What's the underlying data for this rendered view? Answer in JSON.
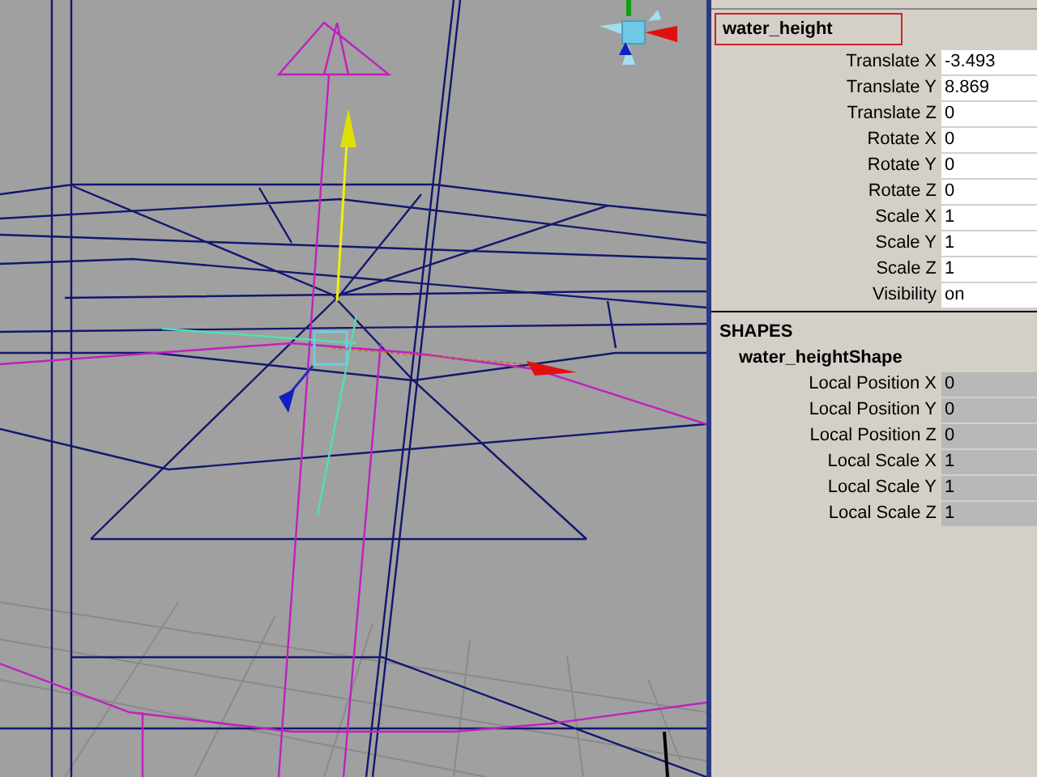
{
  "object": {
    "name": "water_height",
    "attributes": [
      {
        "label": "Translate X",
        "value": "-3.493",
        "disabled": false
      },
      {
        "label": "Translate Y",
        "value": "8.869",
        "disabled": false
      },
      {
        "label": "Translate Z",
        "value": "0",
        "disabled": false
      },
      {
        "label": "Rotate X",
        "value": "0",
        "disabled": false
      },
      {
        "label": "Rotate Y",
        "value": "0",
        "disabled": false
      },
      {
        "label": "Rotate Z",
        "value": "0",
        "disabled": false
      },
      {
        "label": "Scale X",
        "value": "1",
        "disabled": false
      },
      {
        "label": "Scale Y",
        "value": "1",
        "disabled": false
      },
      {
        "label": "Scale Z",
        "value": "1",
        "disabled": false
      },
      {
        "label": "Visibility",
        "value": "on",
        "disabled": false
      }
    ]
  },
  "shapes": {
    "title": "SHAPES",
    "name": "water_heightShape",
    "attributes": [
      {
        "label": "Local Position X",
        "value": "0",
        "disabled": true
      },
      {
        "label": "Local Position Y",
        "value": "0",
        "disabled": true
      },
      {
        "label": "Local Position Z",
        "value": "0",
        "disabled": true
      },
      {
        "label": "Local Scale X",
        "value": "1",
        "disabled": true
      },
      {
        "label": "Local Scale Y",
        "value": "1",
        "disabled": true
      },
      {
        "label": "Local Scale Z",
        "value": "1",
        "disabled": true
      }
    ]
  }
}
